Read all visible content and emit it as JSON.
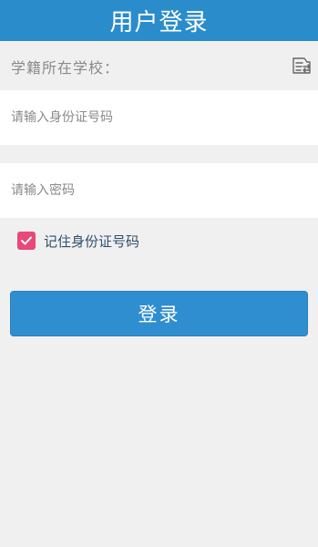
{
  "header": {
    "title": "用户登录"
  },
  "school": {
    "label": "学籍所在学校：",
    "icon": "school-select-icon"
  },
  "id_input": {
    "placeholder": "请输入身份证号码",
    "value": ""
  },
  "password_input": {
    "placeholder": "请输入密码",
    "value": ""
  },
  "remember": {
    "label": "记住身份证号码",
    "checked": true
  },
  "login_button": {
    "label": "登录"
  },
  "colors": {
    "header_bg": "#2b8ccc",
    "button_bg": "#2f8ed0",
    "checkbox": "#e8487a",
    "page_bg": "#f0f0f0"
  }
}
